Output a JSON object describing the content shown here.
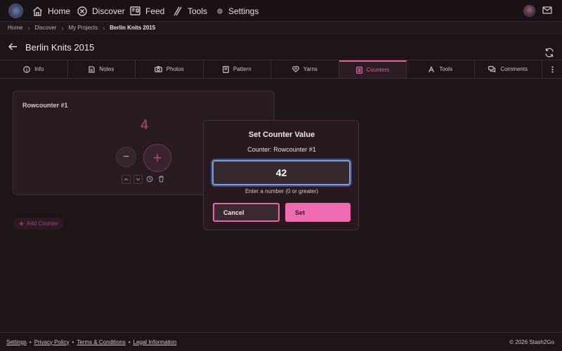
{
  "nav": {
    "items": [
      {
        "label": "Home",
        "icon": "home-icon"
      },
      {
        "label": "Discover",
        "icon": "compass-icon"
      },
      {
        "label": "Feed",
        "icon": "feed-icon"
      },
      {
        "label": "Tools",
        "icon": "tools-icon"
      },
      {
        "label": "Settings",
        "icon": "gear-icon"
      }
    ]
  },
  "breadcrumb": {
    "items": [
      "Home",
      "Discover",
      "My Projects"
    ],
    "current": "Berlin Knits 2015"
  },
  "page": {
    "title": "Berlin Knits 2015"
  },
  "tabs": [
    {
      "label": "Info",
      "icon": "info-icon"
    },
    {
      "label": "Notes",
      "icon": "note-icon"
    },
    {
      "label": "Photos",
      "icon": "camera-icon"
    },
    {
      "label": "Pattern",
      "icon": "pattern-icon"
    },
    {
      "label": "Yarns",
      "icon": "yarn-icon"
    },
    {
      "label": "Counters",
      "icon": "counter-icon",
      "active": true
    },
    {
      "label": "Tools",
      "icon": "tools-icon"
    },
    {
      "label": "Comments",
      "icon": "comments-icon"
    }
  ],
  "counter": {
    "title": "Rowcounter #1",
    "value": "4",
    "minus": "−",
    "plus": "+"
  },
  "add_counter": {
    "label": "Add Counter"
  },
  "modal": {
    "title": "Set Counter Value",
    "subtitle": "Counter: Rowcounter #1",
    "input_value": "42",
    "hint": "Enter a number (0 or greater)",
    "cancel_label": "Cancel",
    "set_label": "Set"
  },
  "footer": {
    "links": [
      "Settings",
      "Privacy Policy",
      "Terms & Conditions",
      "Legal Information"
    ],
    "copyright": "© 2026 Stash2Go"
  },
  "colors": {
    "accent": "#e25fa0",
    "background": "#1e1519",
    "focus": "#7d9fe0"
  }
}
